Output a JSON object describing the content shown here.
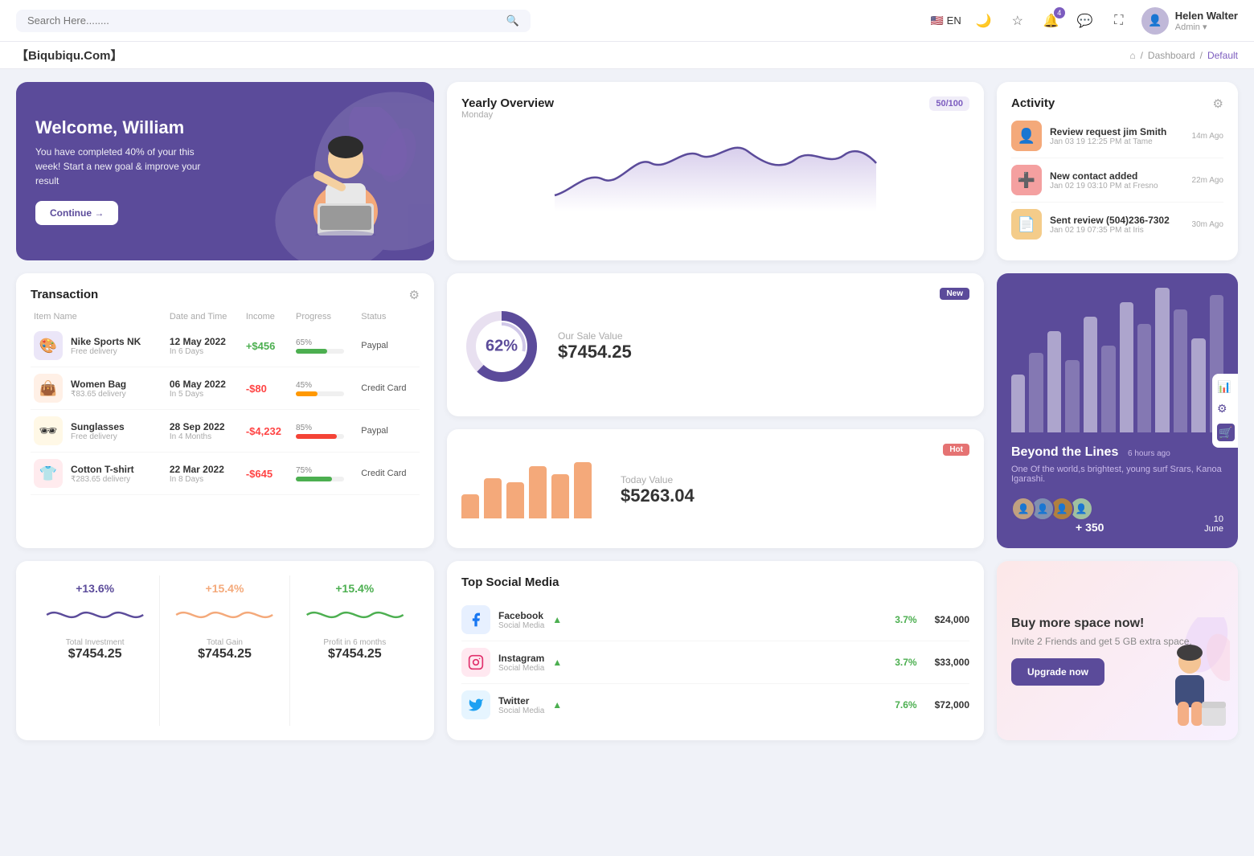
{
  "topnav": {
    "search_placeholder": "Search Here........",
    "lang": "EN",
    "user": {
      "name": "Helen Walter",
      "role": "Admin"
    },
    "notifications_count": "4"
  },
  "breadcrumb": {
    "brand": "【Biqubiqu.Com】",
    "home": "⌂",
    "separator": "/",
    "dashboard": "Dashboard",
    "current": "Default"
  },
  "welcome": {
    "title": "Welcome, William",
    "subtitle": "You have completed 40% of your this week! Start a new goal & improve your result",
    "button": "Continue →"
  },
  "yearly": {
    "title": "Yearly Overview",
    "subtitle": "Monday",
    "badge": "50/100"
  },
  "activity": {
    "title": "Activity",
    "items": [
      {
        "title": "Review request jim Smith",
        "subtitle": "Jan 03 19 12:25 PM at Tame",
        "time": "14m Ago",
        "color": "#f4a97a"
      },
      {
        "title": "New contact added",
        "subtitle": "Jan 02 19 03:10 PM at Fresno",
        "time": "22m Ago",
        "color": "#f4a0a0"
      },
      {
        "title": "Sent review (504)236-7302",
        "subtitle": "Jan 02 19 07:35 PM at Iris",
        "time": "30m Ago",
        "color": "#f4cc8a"
      }
    ]
  },
  "transaction": {
    "title": "Transaction",
    "headers": [
      "Item Name",
      "Date and Time",
      "Income",
      "Progress",
      "Status"
    ],
    "rows": [
      {
        "icon": "🎨",
        "icon_bg": "#ebe6f8",
        "name": "Nike Sports NK",
        "sub": "Free delivery",
        "date": "12 May 2022",
        "days": "In 6 Days",
        "income": "+$456",
        "income_type": "pos",
        "progress": 65,
        "progress_color": "#4caf50",
        "status": "Paypal"
      },
      {
        "icon": "👜",
        "icon_bg": "#fff0e6",
        "name": "Women Bag",
        "sub": "₹83.65 delivery",
        "date": "06 May 2022",
        "days": "In 5 Days",
        "income": "-$80",
        "income_type": "neg",
        "progress": 45,
        "progress_color": "#ff9800",
        "status": "Credit Card"
      },
      {
        "icon": "🕶",
        "icon_bg": "#fff8e6",
        "name": "Sunglasses",
        "sub": "Free delivery",
        "date": "28 Sep 2022",
        "days": "In 4 Months",
        "income": "-$4,232",
        "income_type": "neg",
        "progress": 85,
        "progress_color": "#f44336",
        "status": "Paypal"
      },
      {
        "icon": "👕",
        "icon_bg": "#ffebee",
        "name": "Cotton T-shirt",
        "sub": "₹283.65 delivery",
        "date": "22 Mar 2022",
        "days": "In 8 Days",
        "income": "-$645",
        "income_type": "neg",
        "progress": 75,
        "progress_color": "#4caf50",
        "status": "Credit Card"
      }
    ]
  },
  "sale": {
    "badge": "New",
    "label": "Our Sale Value",
    "value": "$7454.25",
    "percent": "62%",
    "donut_pct": 62
  },
  "today": {
    "badge": "Hot",
    "label": "Today Value",
    "value": "$5263.04",
    "bars": [
      30,
      50,
      45,
      65,
      55,
      70
    ]
  },
  "beyond": {
    "title": "Beyond the Lines",
    "time": "6 hours ago",
    "desc": "One Of the world,s brightest, young surf Srars, Kanoa Igarashi.",
    "count": "+ 350",
    "date": "10",
    "month": "June",
    "bars": [
      40,
      55,
      70,
      50,
      80,
      60,
      90,
      75,
      100,
      85,
      65,
      95
    ]
  },
  "stats": [
    {
      "pct": "+13.6%",
      "label": "Total Investment",
      "value": "$7454.25",
      "color": "#5b4b9a",
      "wave_id": "w1"
    },
    {
      "pct": "+15.4%",
      "label": "Total Gain",
      "value": "$7454.25",
      "color": "#f4a97a",
      "wave_id": "w2"
    },
    {
      "pct": "+15.4%",
      "label": "Profit in 6 months",
      "value": "$7454.25",
      "color": "#4caf50",
      "wave_id": "w3"
    }
  ],
  "social": {
    "title": "Top Social Media",
    "items": [
      {
        "name": "Facebook",
        "type": "Social Media",
        "pct": "3.7%",
        "amount": "$24,000",
        "icon": "f",
        "icon_color": "#1877f2",
        "icon_bg": "#e7f0ff"
      },
      {
        "name": "Instagram",
        "type": "Social Media",
        "pct": "3.7%",
        "amount": "$33,000",
        "icon": "ig",
        "icon_color": "#e1306c",
        "icon_bg": "#ffe8f0"
      },
      {
        "name": "Twitter",
        "type": "Social Media",
        "pct": "7.6%",
        "amount": "$72,000",
        "icon": "tw",
        "icon_color": "#1da1f2",
        "icon_bg": "#e6f5ff"
      }
    ]
  },
  "buyspace": {
    "title": "Buy more space now!",
    "desc": "Invite 2 Friends and get 5 GB extra space.",
    "button": "Upgrade now"
  }
}
